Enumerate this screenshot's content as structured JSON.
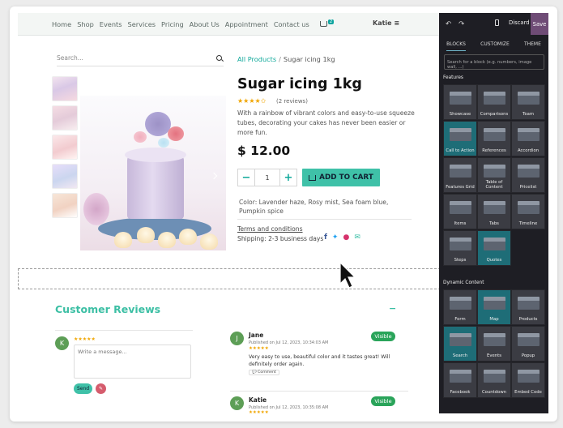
{
  "nav": {
    "items": [
      "Home",
      "Shop",
      "Events",
      "Services",
      "Pricing",
      "About Us",
      "Appointment",
      "Contact us"
    ],
    "cart_count": "2",
    "user": "Katie"
  },
  "search": {
    "placeholder": "Search..."
  },
  "breadcrumb": {
    "link": "All Products",
    "sep": "/",
    "current": "Sugar icing 1kg"
  },
  "product": {
    "title": "Sugar icing 1kg",
    "stars": "★★★★✩",
    "reviews": "(2 reviews)",
    "description": "With a rainbow of vibrant colors and easy-to-use squeeze tubes, decorating your cakes has never been easier or more fun.",
    "price": "$ 12.00",
    "qty": "1",
    "minus": "−",
    "plus": "+",
    "add_to_cart": "ADD TO CART",
    "color": "Color: Lavender haze, Rosy mist, Sea foam blue, Pumpkin spice",
    "terms": "Terms and conditions",
    "shipping": "Shipping: 2-3 business days"
  },
  "reviews": {
    "title": "Customer Reviews",
    "collapse": "−",
    "my_avatar": "K",
    "my_stars": "★★★★★",
    "placeholder": "Write a message...",
    "send": "Send",
    "attach": "✎",
    "items": [
      {
        "avatar": "J",
        "name": "Jane",
        "date": "Published on Jul 12, 2023, 10:34:03 AM",
        "stars": "★★★★★",
        "text": "Very easy to use, beautiful color and it tastes great! Will definitely order again.",
        "comment": "💬 Comment",
        "badge": "Visible"
      },
      {
        "avatar": "K",
        "name": "Katie",
        "date": "Published on Jul 12, 2023, 10:35:08 AM",
        "stars": "★★★★★",
        "badge": "Visible"
      }
    ]
  },
  "editor": {
    "discard": "Discard",
    "save": "Save",
    "tabs": [
      "BLOCKS",
      "CUSTOMIZE",
      "THEME"
    ],
    "search_placeholder": "Search for a block (e.g. numbers, image wall, ...)",
    "features_label": "Features",
    "dynamic_label": "Dynamic Content",
    "features": [
      "Showcase",
      "Comparisons",
      "Team",
      "Call to Action",
      "References",
      "Accordion",
      "Features Grid",
      "Table of Content",
      "Pricelist",
      "Items",
      "Tabs",
      "Timeline",
      "Steps",
      "Quotes"
    ],
    "dynamic": [
      "Form",
      "Map",
      "Products",
      "Search",
      "Events",
      "Popup",
      "Facebook",
      "Countdown",
      "Embed Code"
    ]
  },
  "colors": {
    "accent": "#3fc1a8",
    "teal": "#11a99b",
    "save": "#6f4c76",
    "panel": "#1e1e24",
    "visible": "#2aa45a"
  }
}
